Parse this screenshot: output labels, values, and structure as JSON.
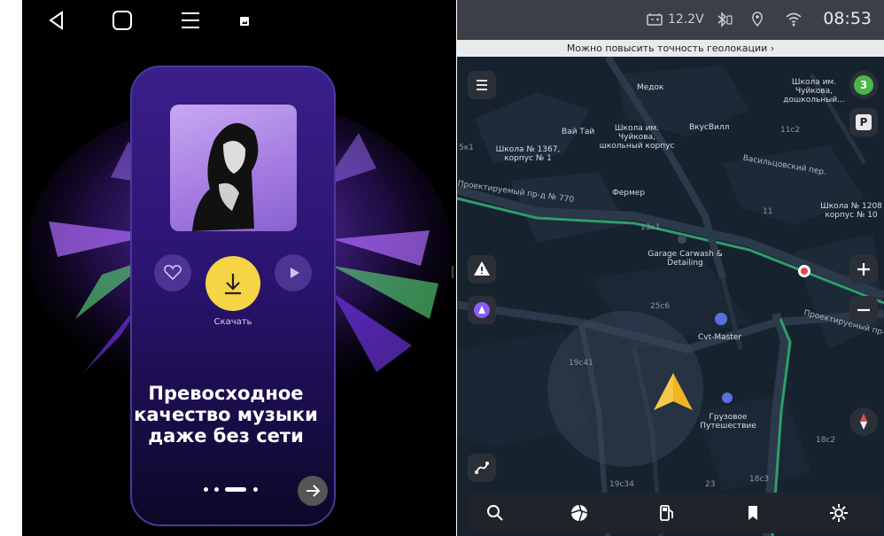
{
  "left_panel": {
    "nav_icons": [
      "back-icon",
      "home-square-icon",
      "menu-lines-icon",
      "screenshot-icon"
    ],
    "download_label": "Скачать",
    "headline": "Превосходное качество музыки даже без сети",
    "headline_lines": [
      "Превосходное",
      "качество музыки",
      "даже без сети"
    ]
  },
  "right_panel": {
    "status": {
      "battery_voltage": "12.2V",
      "time": "08:53"
    },
    "geo_banner": "Можно повысить точность геолокации ›",
    "traffic_badge": "3",
    "parking_badge": "P",
    "map_labels": [
      {
        "text": "Медок",
        "key": "medok"
      },
      {
        "text": "Школа им. Чуйкова, дошкольный...",
        "key": "school_chuykov_preschool"
      },
      {
        "text": "Вай Тай",
        "key": "vaitai"
      },
      {
        "text": "Школа им. Чуйкова, школьный корпус",
        "key": "school_chuykov"
      },
      {
        "text": "ВкусВилл",
        "key": "vkusvill"
      },
      {
        "text": "Школа № 1367, корпус № 1",
        "key": "school1367"
      },
      {
        "text": "Фермер",
        "key": "fermer"
      },
      {
        "text": "Школа № 1208 корпус № 10",
        "key": "school1208"
      },
      {
        "text": "Garage Carwash & Detailing",
        "key": "garage"
      },
      {
        "text": "Cvt-Master",
        "key": "cvt"
      },
      {
        "text": "Грузовое Путешествие",
        "key": "gruzovoe"
      }
    ],
    "street_labels": {
      "proezd770": "Проектируемый пр-д № 770",
      "vasilcovsky": "Васильцовский пер.",
      "proekt_right": "Проектируемый пр-д №"
    },
    "house_numbers": {
      "n13k1": "13к1",
      "n25c6": "25с6",
      "n19c41": "19с41",
      "n11": "11",
      "n11c2": "11с2",
      "n18c2": "18с2",
      "n18c3": "18с3",
      "n19c34": "19с34",
      "n23": "23",
      "n5k1": "5к1"
    },
    "bottom_bar": [
      "search-icon",
      "camera-aperture-icon",
      "fuel-icon",
      "bookmarks-icon",
      "settings-gear-icon"
    ]
  },
  "colors": {
    "download_yellow": "#f5d445",
    "phone_purple": "#3a1f8a",
    "map_bg": "#15202d",
    "route_green": "#2f9d6a",
    "nav_arrow": "#f0b323"
  }
}
